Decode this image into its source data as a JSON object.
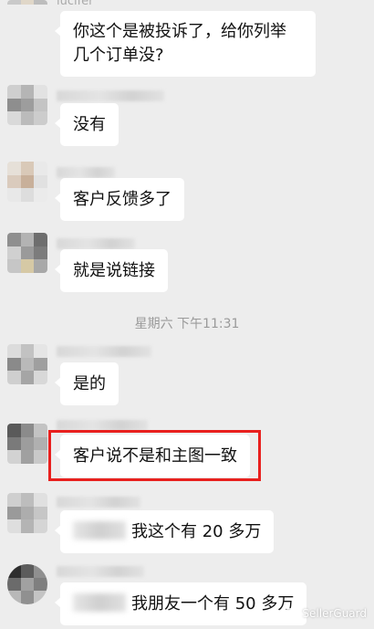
{
  "chat": {
    "top_sender_fragment": "lucifer",
    "timestamp": "星期六 下午11:31",
    "messages": [
      {
        "text": "你这个是被投诉了，给你列举\n几个订单没?"
      },
      {
        "text": "没有"
      },
      {
        "text": "客户反馈多了"
      },
      {
        "text": "就是说链接"
      },
      {
        "text": "是的"
      },
      {
        "text": "客户说不是和主图一致"
      },
      {
        "text": "我这个有 20 多万"
      },
      {
        "text": "我朋友一个有 50 多万"
      }
    ]
  },
  "watermark": {
    "label": "SellerGuard",
    "icon": "wechat-icon"
  },
  "colors": {
    "background": "#ededed",
    "bubble": "#ffffff",
    "highlight": "#e8201e"
  }
}
